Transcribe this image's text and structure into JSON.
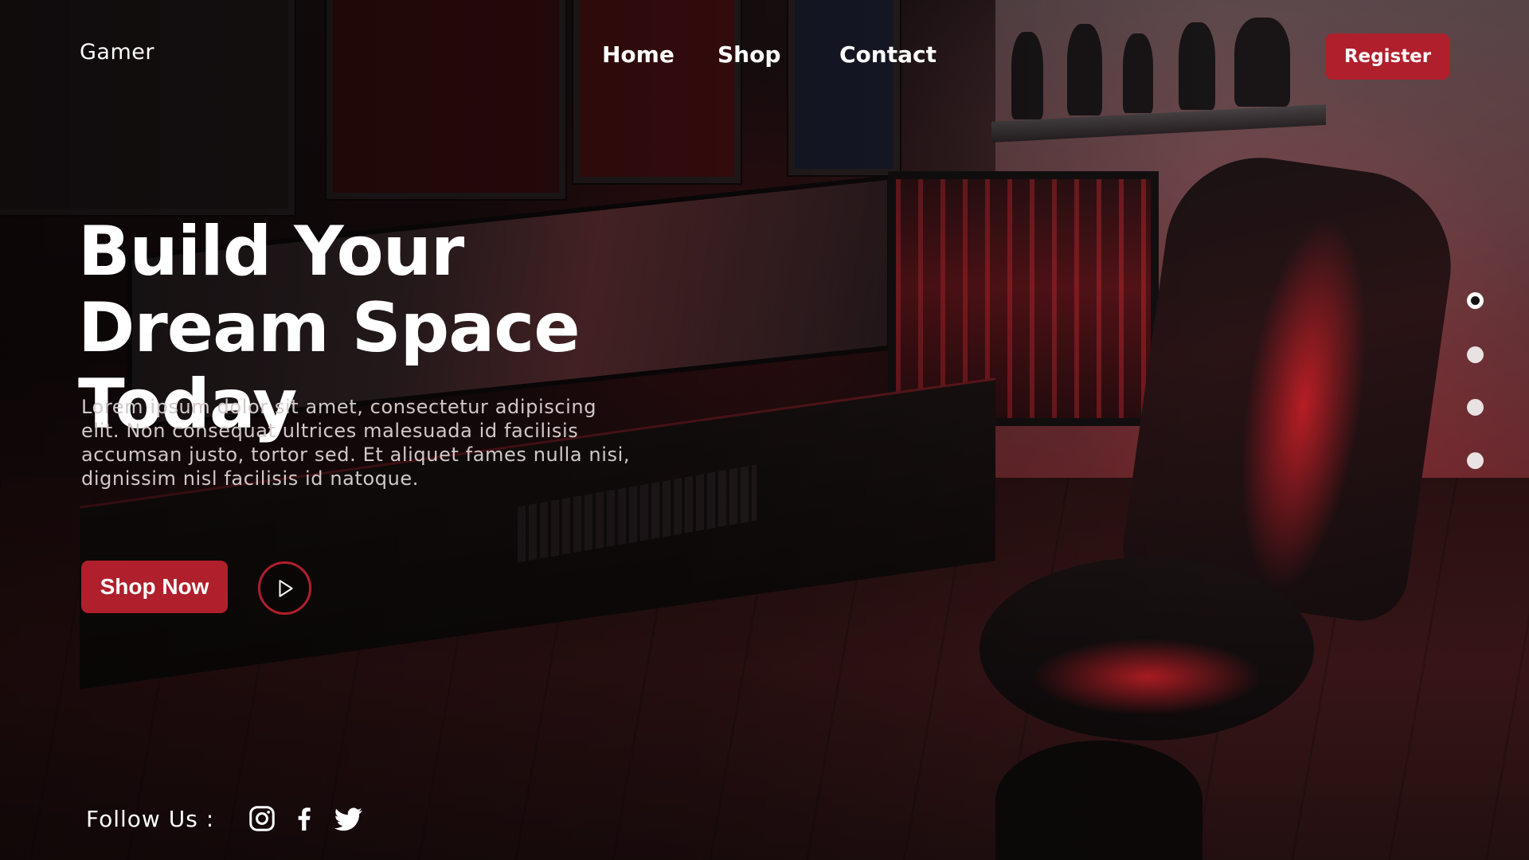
{
  "header": {
    "brand": "Gamer",
    "nav": {
      "home": "Home",
      "shop": "Shop",
      "contact": "Contact"
    },
    "register_label": "Register"
  },
  "hero": {
    "title": "Build Your Dream Space Today",
    "description": "Lorem ipsum dolor sit amet, consectetur adipiscing elit. Non consequat ultrices malesuada id facilisis accumsan justo, tortor sed. Et aliquet fames nulla nisi, dignissim nisl facilisis id natoque.",
    "shop_now_label": "Shop Now",
    "play_icon": "play-icon"
  },
  "slider": {
    "active_index": 1,
    "total": 4
  },
  "footer": {
    "follow_label": "Follow Us :",
    "social_icons": [
      "instagram-icon",
      "facebook-icon",
      "twitter-icon"
    ]
  },
  "colors": {
    "accent": "#b01f2c",
    "text": "#ffffff",
    "muted_text": "#d2c8c9"
  }
}
